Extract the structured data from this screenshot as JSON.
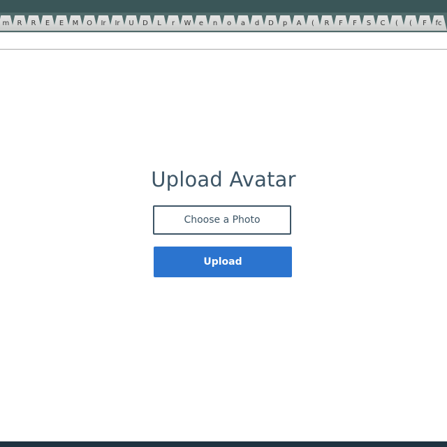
{
  "browser": {
    "tabs": [
      "m",
      "R",
      "R",
      "E",
      "E",
      "M",
      "O",
      "Ir",
      "Ir",
      "U",
      "D",
      "L",
      "r",
      "W",
      "e",
      "n",
      "o",
      "a",
      "d",
      "D",
      "p",
      "A",
      "(",
      "R",
      "F",
      "F",
      "S",
      "C",
      "(",
      "(",
      "F",
      "fc"
    ]
  },
  "page": {
    "title": "Upload Avatar",
    "choose_label": "Choose a Photo",
    "upload_label": "Upload"
  },
  "colors": {
    "accent": "#2b74cf",
    "title_text": "#3d5566",
    "tabstrip_bg": "#4f6a6a"
  }
}
